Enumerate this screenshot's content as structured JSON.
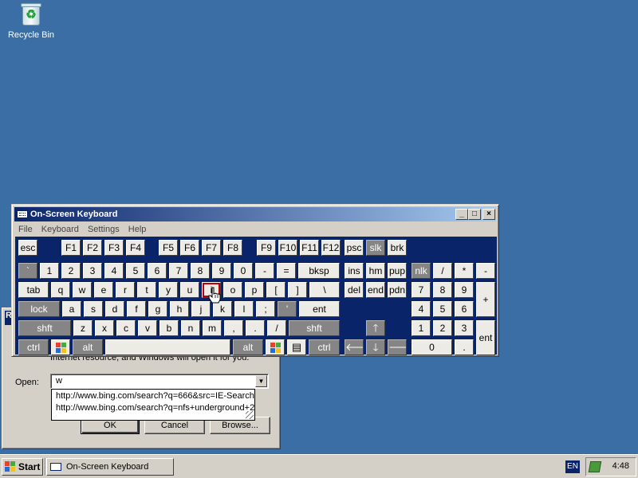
{
  "desktop": {
    "recycle_bin_label": "Recycle Bin"
  },
  "run_dialog": {
    "description": "Internet resource, and Windows will open it for you.",
    "open_label": "Open:",
    "open_value": "w",
    "autocomplete": [
      "http://www.bing.com/search?q=666&src=IE-SearchBox",
      "http://www.bing.com/search?q=nfs+underground+2"
    ],
    "ok_label": "OK",
    "cancel_label": "Cancel",
    "browse_label": "Browse..."
  },
  "osk": {
    "title": "On-Screen Keyboard",
    "menu": [
      "File",
      "Keyboard",
      "Settings",
      "Help"
    ],
    "keys": {
      "esc": "esc",
      "f1": "F1",
      "f2": "F2",
      "f3": "F3",
      "f4": "F4",
      "f5": "F5",
      "f6": "F6",
      "f7": "F7",
      "f8": "F8",
      "f9": "F9",
      "f10": "F10",
      "f11": "F11",
      "f12": "F12",
      "psc": "psc",
      "slk": "slk",
      "brk": "brk",
      "backtick": "`",
      "n1": "1",
      "n2": "2",
      "n3": "3",
      "n4": "4",
      "n5": "5",
      "n6": "6",
      "n7": "7",
      "n8": "8",
      "n9": "9",
      "n0": "0",
      "minus": "-",
      "equals": "=",
      "bksp": "bksp",
      "ins": "ins",
      "hm": "hm",
      "pup": "pup",
      "nlk": "nlk",
      "slash": "/",
      "star": "*",
      "np_minus": "-",
      "tab": "tab",
      "q": "q",
      "w": "w",
      "e": "e",
      "r": "r",
      "t": "t",
      "y": "y",
      "u": "u",
      "i": "i",
      "o": "o",
      "p": "p",
      "lbracket": "[",
      "rbracket": "]",
      "backslash": "\\",
      "del": "del",
      "end": "end",
      "pdn": "pdn",
      "np7": "7",
      "np8": "8",
      "np9": "9",
      "np_plus": "+",
      "lock": "lock",
      "a": "a",
      "s": "s",
      "d": "d",
      "f": "f",
      "g": "g",
      "h": "h",
      "j": "j",
      "k": "k",
      "l": "l",
      "semicolon": ";",
      "quote": "'",
      "ent": "ent",
      "np4": "4",
      "np5": "5",
      "np6": "6",
      "shft": "shft",
      "z": "z",
      "x": "x",
      "c": "c",
      "v": "v",
      "b": "b",
      "n": "n",
      "m": "m",
      "comma": ",",
      "period": ".",
      "fslash": "/",
      "rshft": "shft",
      "np1": "1",
      "np2": "2",
      "np3": "3",
      "np_ent": "ent",
      "ctrl": "ctrl",
      "alt": "alt",
      "ralt": "alt",
      "rctrl": "ctrl",
      "np0": "0",
      "np_dot": "."
    }
  },
  "taskbar": {
    "start_label": "Start",
    "task_label": "On-Screen Keyboard",
    "language": "EN",
    "clock": "4:48"
  }
}
